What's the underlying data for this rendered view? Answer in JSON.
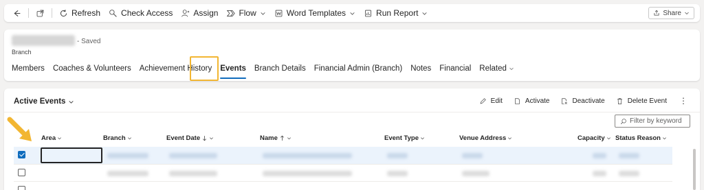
{
  "command_bar": {
    "items": [
      {
        "label": "Refresh",
        "icon": "refresh-icon"
      },
      {
        "label": "Check Access",
        "icon": "check-access-icon"
      },
      {
        "label": "Assign",
        "icon": "assign-icon"
      },
      {
        "label": "Flow",
        "icon": "flow-icon"
      },
      {
        "label": "Word Templates",
        "icon": "word-templates-icon"
      },
      {
        "label": "Run Report",
        "icon": "run-report-icon"
      }
    ],
    "share_label": "Share"
  },
  "record": {
    "saved_status": "- Saved",
    "entity_name": "Branch",
    "tabs": [
      {
        "label": "Members"
      },
      {
        "label": "Coaches & Volunteers"
      },
      {
        "label": "Achievement History"
      },
      {
        "label": "Events",
        "active": true
      },
      {
        "label": "Branch Details"
      },
      {
        "label": "Financial Admin (Branch)"
      },
      {
        "label": "Notes"
      },
      {
        "label": "Financial"
      },
      {
        "label": "Related"
      }
    ]
  },
  "grid": {
    "view_name": "Active Events",
    "actions": [
      {
        "label": "Edit",
        "icon": "edit-icon"
      },
      {
        "label": "Activate",
        "icon": "activate-icon"
      },
      {
        "label": "Deactivate",
        "icon": "deactivate-icon"
      },
      {
        "label": "Delete Event",
        "icon": "delete-icon"
      }
    ],
    "filter_placeholder": "Filter by keyword",
    "columns": [
      {
        "label": "Area",
        "sort": "none"
      },
      {
        "label": "Branch",
        "sort": "none"
      },
      {
        "label": "Event Date",
        "sort": "desc"
      },
      {
        "label": "Name",
        "sort": "asc"
      },
      {
        "label": "Event Type",
        "sort": "none"
      },
      {
        "label": "Venue Address",
        "sort": "none"
      },
      {
        "label": "Capacity",
        "sort": "none"
      },
      {
        "label": "Status Reason",
        "sort": "none"
      }
    ],
    "rows": [
      {
        "selected": true
      },
      {
        "selected": false
      },
      {
        "selected": false
      }
    ]
  },
  "colors": {
    "accent": "#0f6cbd",
    "highlight": "#f2b632",
    "selected_row": "#ebf3fc"
  }
}
